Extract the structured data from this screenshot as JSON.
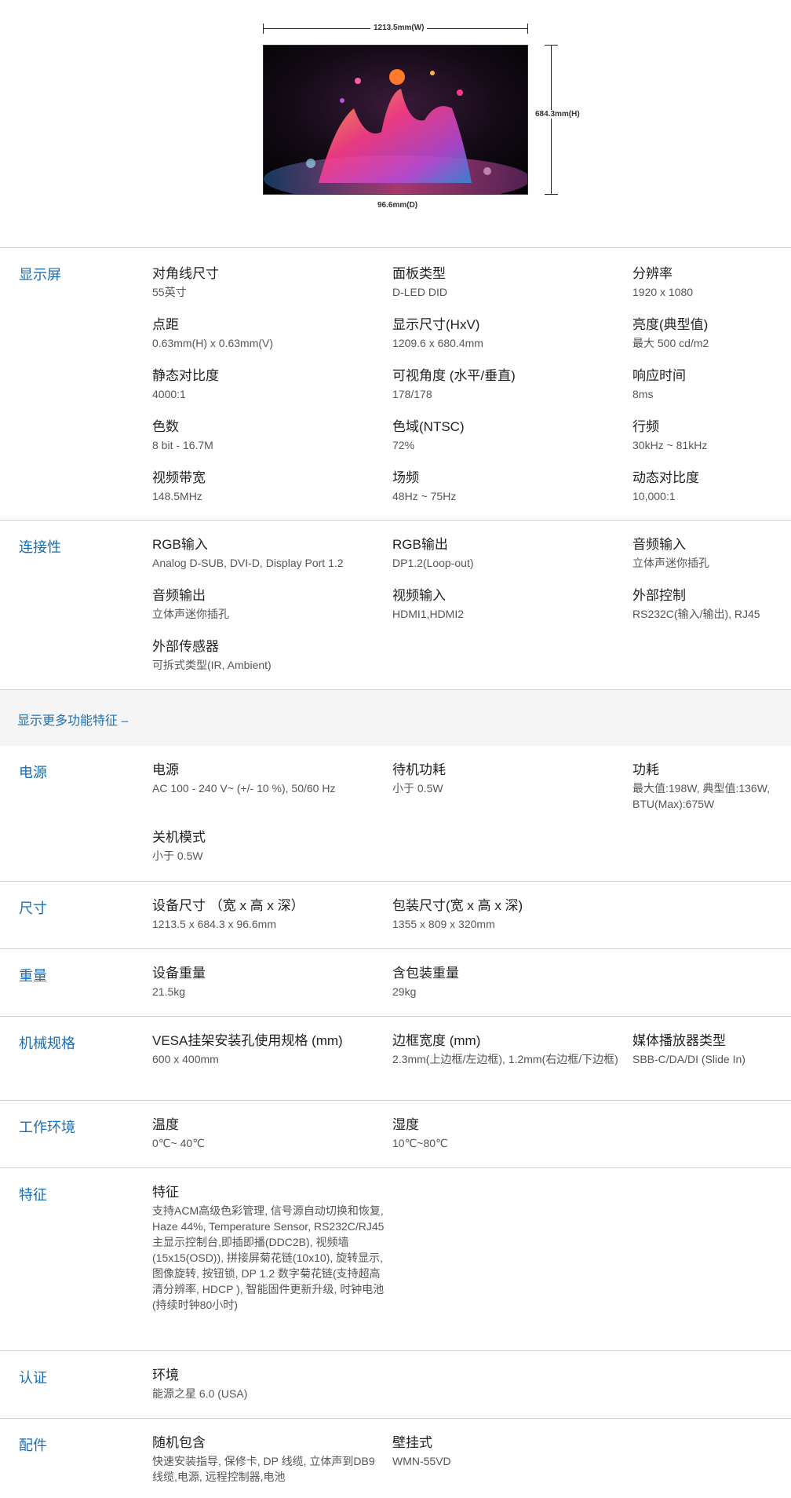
{
  "diagram": {
    "width_label": "1213.5mm(W)",
    "height_label": "684.3mm(H)",
    "depth_label": "96.6mm(D)"
  },
  "more_link": "显示更多功能特征 –",
  "sections": {
    "display": {
      "title": "显示屏",
      "items": [
        {
          "label": "对角线尺寸",
          "value": "55英寸"
        },
        {
          "label": "面板类型",
          "value": "D-LED DID"
        },
        {
          "label": "分辨率",
          "value": "1920 x 1080"
        },
        {
          "label": "点距",
          "value": "0.63mm(H) x 0.63mm(V)"
        },
        {
          "label": "显示尺寸(HxV)",
          "value": "1209.6 x 680.4mm"
        },
        {
          "label": "亮度(典型值)",
          "value": "最大 500 cd/m2"
        },
        {
          "label": "静态对比度",
          "value": "4000:1"
        },
        {
          "label": "可视角度 (水平/垂直)",
          "value": "178/178"
        },
        {
          "label": "响应时间",
          "value": "8ms"
        },
        {
          "label": "色数",
          "value": "8 bit - 16.7M"
        },
        {
          "label": "色域(NTSC)",
          "value": "72%"
        },
        {
          "label": "行频",
          "value": "30kHz ~ 81kHz"
        },
        {
          "label": "视频带宽",
          "value": "148.5MHz"
        },
        {
          "label": "场频",
          "value": "48Hz ~ 75Hz"
        },
        {
          "label": "动态对比度",
          "value": "10,000:1"
        }
      ]
    },
    "connectivity": {
      "title": "连接性",
      "items": [
        {
          "label": "RGB输入",
          "value": "Analog D-SUB, DVI-D, Display Port 1.2"
        },
        {
          "label": "RGB输出",
          "value": "DP1.2(Loop-out)"
        },
        {
          "label": "音频输入",
          "value": "立体声迷你插孔"
        },
        {
          "label": "音频输出",
          "value": "立体声迷你插孔"
        },
        {
          "label": "视频输入",
          "value": "HDMI1,HDMI2"
        },
        {
          "label": "外部控制",
          "value": "RS232C(输入/输出), RJ45"
        },
        {
          "label": "外部传感器",
          "value": "可拆式类型(IR, Ambient)"
        }
      ]
    },
    "power": {
      "title": "电源",
      "items": [
        {
          "label": "电源",
          "value": "AC 100 - 240 V~ (+/- 10 %), 50/60 Hz"
        },
        {
          "label": "待机功耗",
          "value": "小于 0.5W"
        },
        {
          "label": "功耗",
          "value": "最大值:198W, 典型值:136W, BTU(Max):675W"
        },
        {
          "label": "关机模式",
          "value": "小于 0.5W"
        }
      ]
    },
    "dimensions": {
      "title": "尺寸",
      "items": [
        {
          "label": "设备尺寸 （宽 x 高 x 深）",
          "value": "1213.5 x 684.3 x 96.6mm"
        },
        {
          "label": "包装尺寸(宽 x 高 x 深)",
          "value": "1355 x 809 x 320mm"
        }
      ]
    },
    "weight": {
      "title": "重量",
      "items": [
        {
          "label": "设备重量",
          "value": "21.5kg"
        },
        {
          "label": "含包装重量",
          "value": "29kg"
        }
      ]
    },
    "mechanical": {
      "title": "机械规格",
      "items": [
        {
          "label": "VESA挂架安装孔使用规格 (mm)",
          "value": "600 x 400mm"
        },
        {
          "label": "边框宽度 (mm)",
          "value": "2.3mm(上边框/左边框), 1.2mm(右边框/下边框)"
        },
        {
          "label": "媒体播放器类型",
          "value": "SBB-C/DA/DI (Slide In)"
        }
      ]
    },
    "environment": {
      "title": "工作环境",
      "items": [
        {
          "label": "温度",
          "value": "0℃~ 40℃"
        },
        {
          "label": "湿度",
          "value": "10℃~80℃"
        }
      ]
    },
    "features": {
      "title": "特征",
      "items": [
        {
          "label": "特征",
          "value": "支持ACM高级色彩管理, 信号源自动切换和恢复, Haze 44%, Temperature Sensor, RS232C/RJ45 主显示控制台,即插即播(DDC2B), 视频墙(15x15(OSD)), 拼接屏菊花链(10x10), 旋转显示, 图像旋转, 按钮锁, DP 1.2 数字菊花链(支持超高清分辨率, HDCP ), 智能固件更新升级, 时钟电池(持续时钟80小时)"
        }
      ]
    },
    "certification": {
      "title": "认证",
      "items": [
        {
          "label": "环境",
          "value": "能源之星 6.0 (USA)"
        }
      ]
    },
    "accessories": {
      "title": "配件",
      "items": [
        {
          "label": "随机包含",
          "value": "快速安装指导, 保修卡, DP 线缆, 立体声到DB9线缆,电源, 远程控制器,电池"
        },
        {
          "label": "壁挂式",
          "value": "WMN-55VD"
        }
      ]
    }
  }
}
